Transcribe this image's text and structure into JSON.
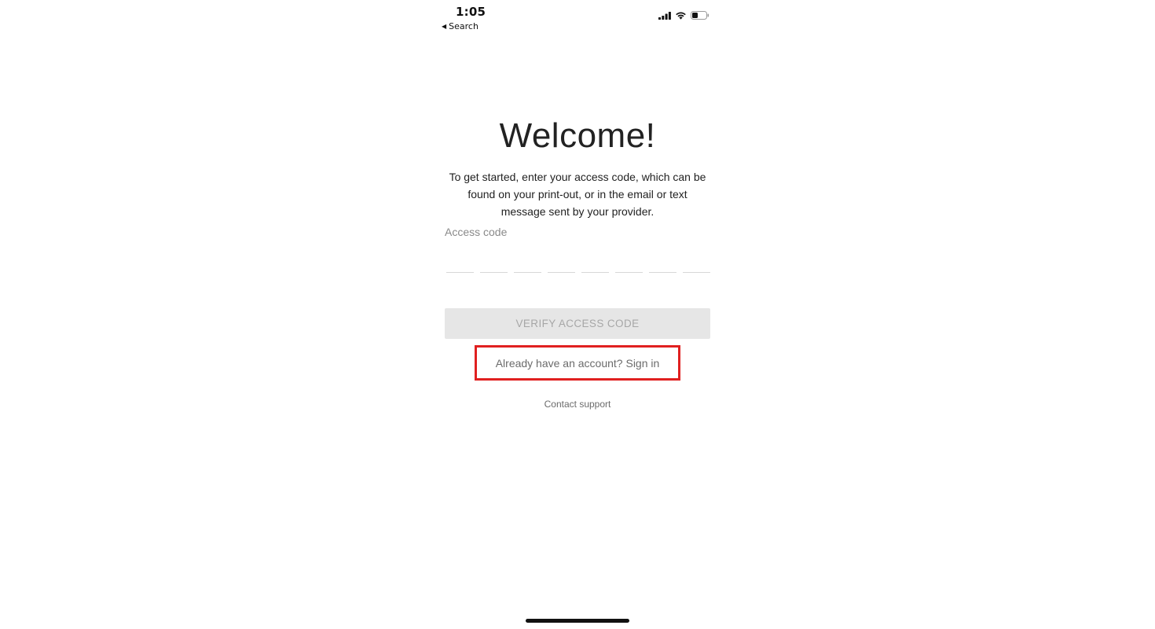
{
  "status_bar": {
    "time": "1:05",
    "back_label": "Search",
    "back_icon": "back-triangle-icon",
    "icons": [
      "cellular-signal-icon",
      "wifi-icon",
      "battery-icon"
    ]
  },
  "main": {
    "title": "Welcome!",
    "intro": "To get started, enter your access code, which can be found on your print-out, or in the email or text message sent by your provider.",
    "access_code_label": "Access code",
    "access_code_digits": [
      "",
      "",
      "",
      "",
      "",
      "",
      "",
      ""
    ],
    "verify_button_label": "VERIFY ACCESS CODE",
    "verify_button_enabled": false,
    "signin_link": "Already have an account? Sign in",
    "support_link": "Contact support"
  },
  "colors": {
    "highlight_border": "#e02020",
    "disabled_button_bg": "#e6e6e6",
    "disabled_button_text": "#a7a7a7",
    "secondary_text": "#6b6b6b"
  }
}
